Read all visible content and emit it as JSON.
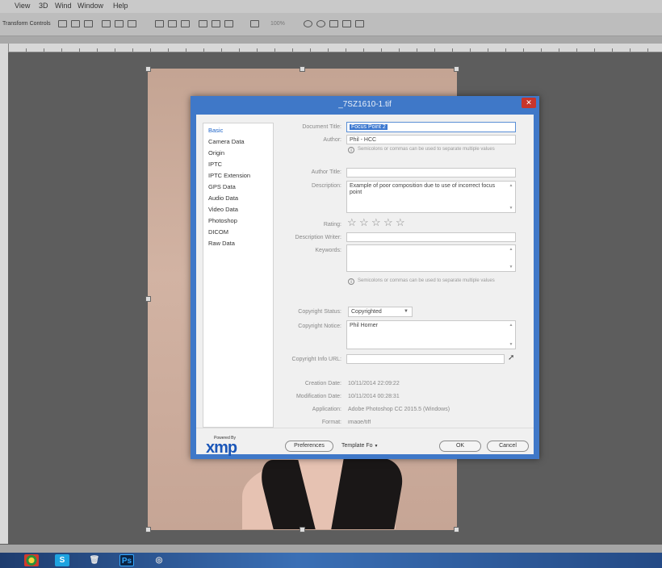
{
  "app": {
    "menu": [
      "View",
      "3D",
      "Wind",
      "Window",
      "Help"
    ],
    "options_label": "Transform Controls",
    "zoom_field": "100%"
  },
  "dialog": {
    "title": "_7SZ1610-1.tif",
    "close_glyph": "✕",
    "sidebar_items": [
      "Basic",
      "Camera Data",
      "Origin",
      "IPTC",
      "IPTC Extension",
      "GPS Data",
      "Audio Data",
      "Video Data",
      "Photoshop",
      "DICOM",
      "Raw Data"
    ],
    "fields": {
      "document_title_label": "Document Title:",
      "document_title_value": "Focus Point 2",
      "author_label": "Author:",
      "author_value": "Phil - HCC",
      "separator_note": "Semicolons or commas can be used to separate multiple values",
      "author_title_label": "Author Title:",
      "description_label": "Description:",
      "description_value": "Example of poor composition due to use of incorrect focus point",
      "rating_label": "Rating:",
      "description_writer_label": "Description Writer:",
      "keywords_label": "Keywords:",
      "copyright_status_label": "Copyright Status:",
      "copyright_status_value": "Copyrighted",
      "copyright_notice_label": "Copyright Notice:",
      "copyright_notice_value": "Phil Horner",
      "copyright_url_label": "Copyright Info URL:",
      "creation_date_label": "Creation Date:",
      "creation_date_value": "10/11/2014 22:09:22",
      "modification_date_label": "Modification Date:",
      "modification_date_value": "10/11/2014 00:28:31",
      "application_label": "Application:",
      "application_value": "Adobe Photoshop CC 2015.5 (Windows)",
      "format_label": "Format:",
      "format_value": "image/tiff"
    },
    "rating_stars": 5,
    "rating_value": 0,
    "footer": {
      "powered_by": "Powered By",
      "xmp": "xmp",
      "preferences": "Preferences",
      "template": "Template Fo",
      "ok": "OK",
      "cancel": "Cancel"
    }
  },
  "taskbar": {
    "apps": [
      "chrome-icon",
      "skype-icon",
      "recycle-bin-icon",
      "photoshop-icon",
      "app-icon"
    ],
    "photoshop_label": "Ps",
    "skype_label": "S"
  }
}
